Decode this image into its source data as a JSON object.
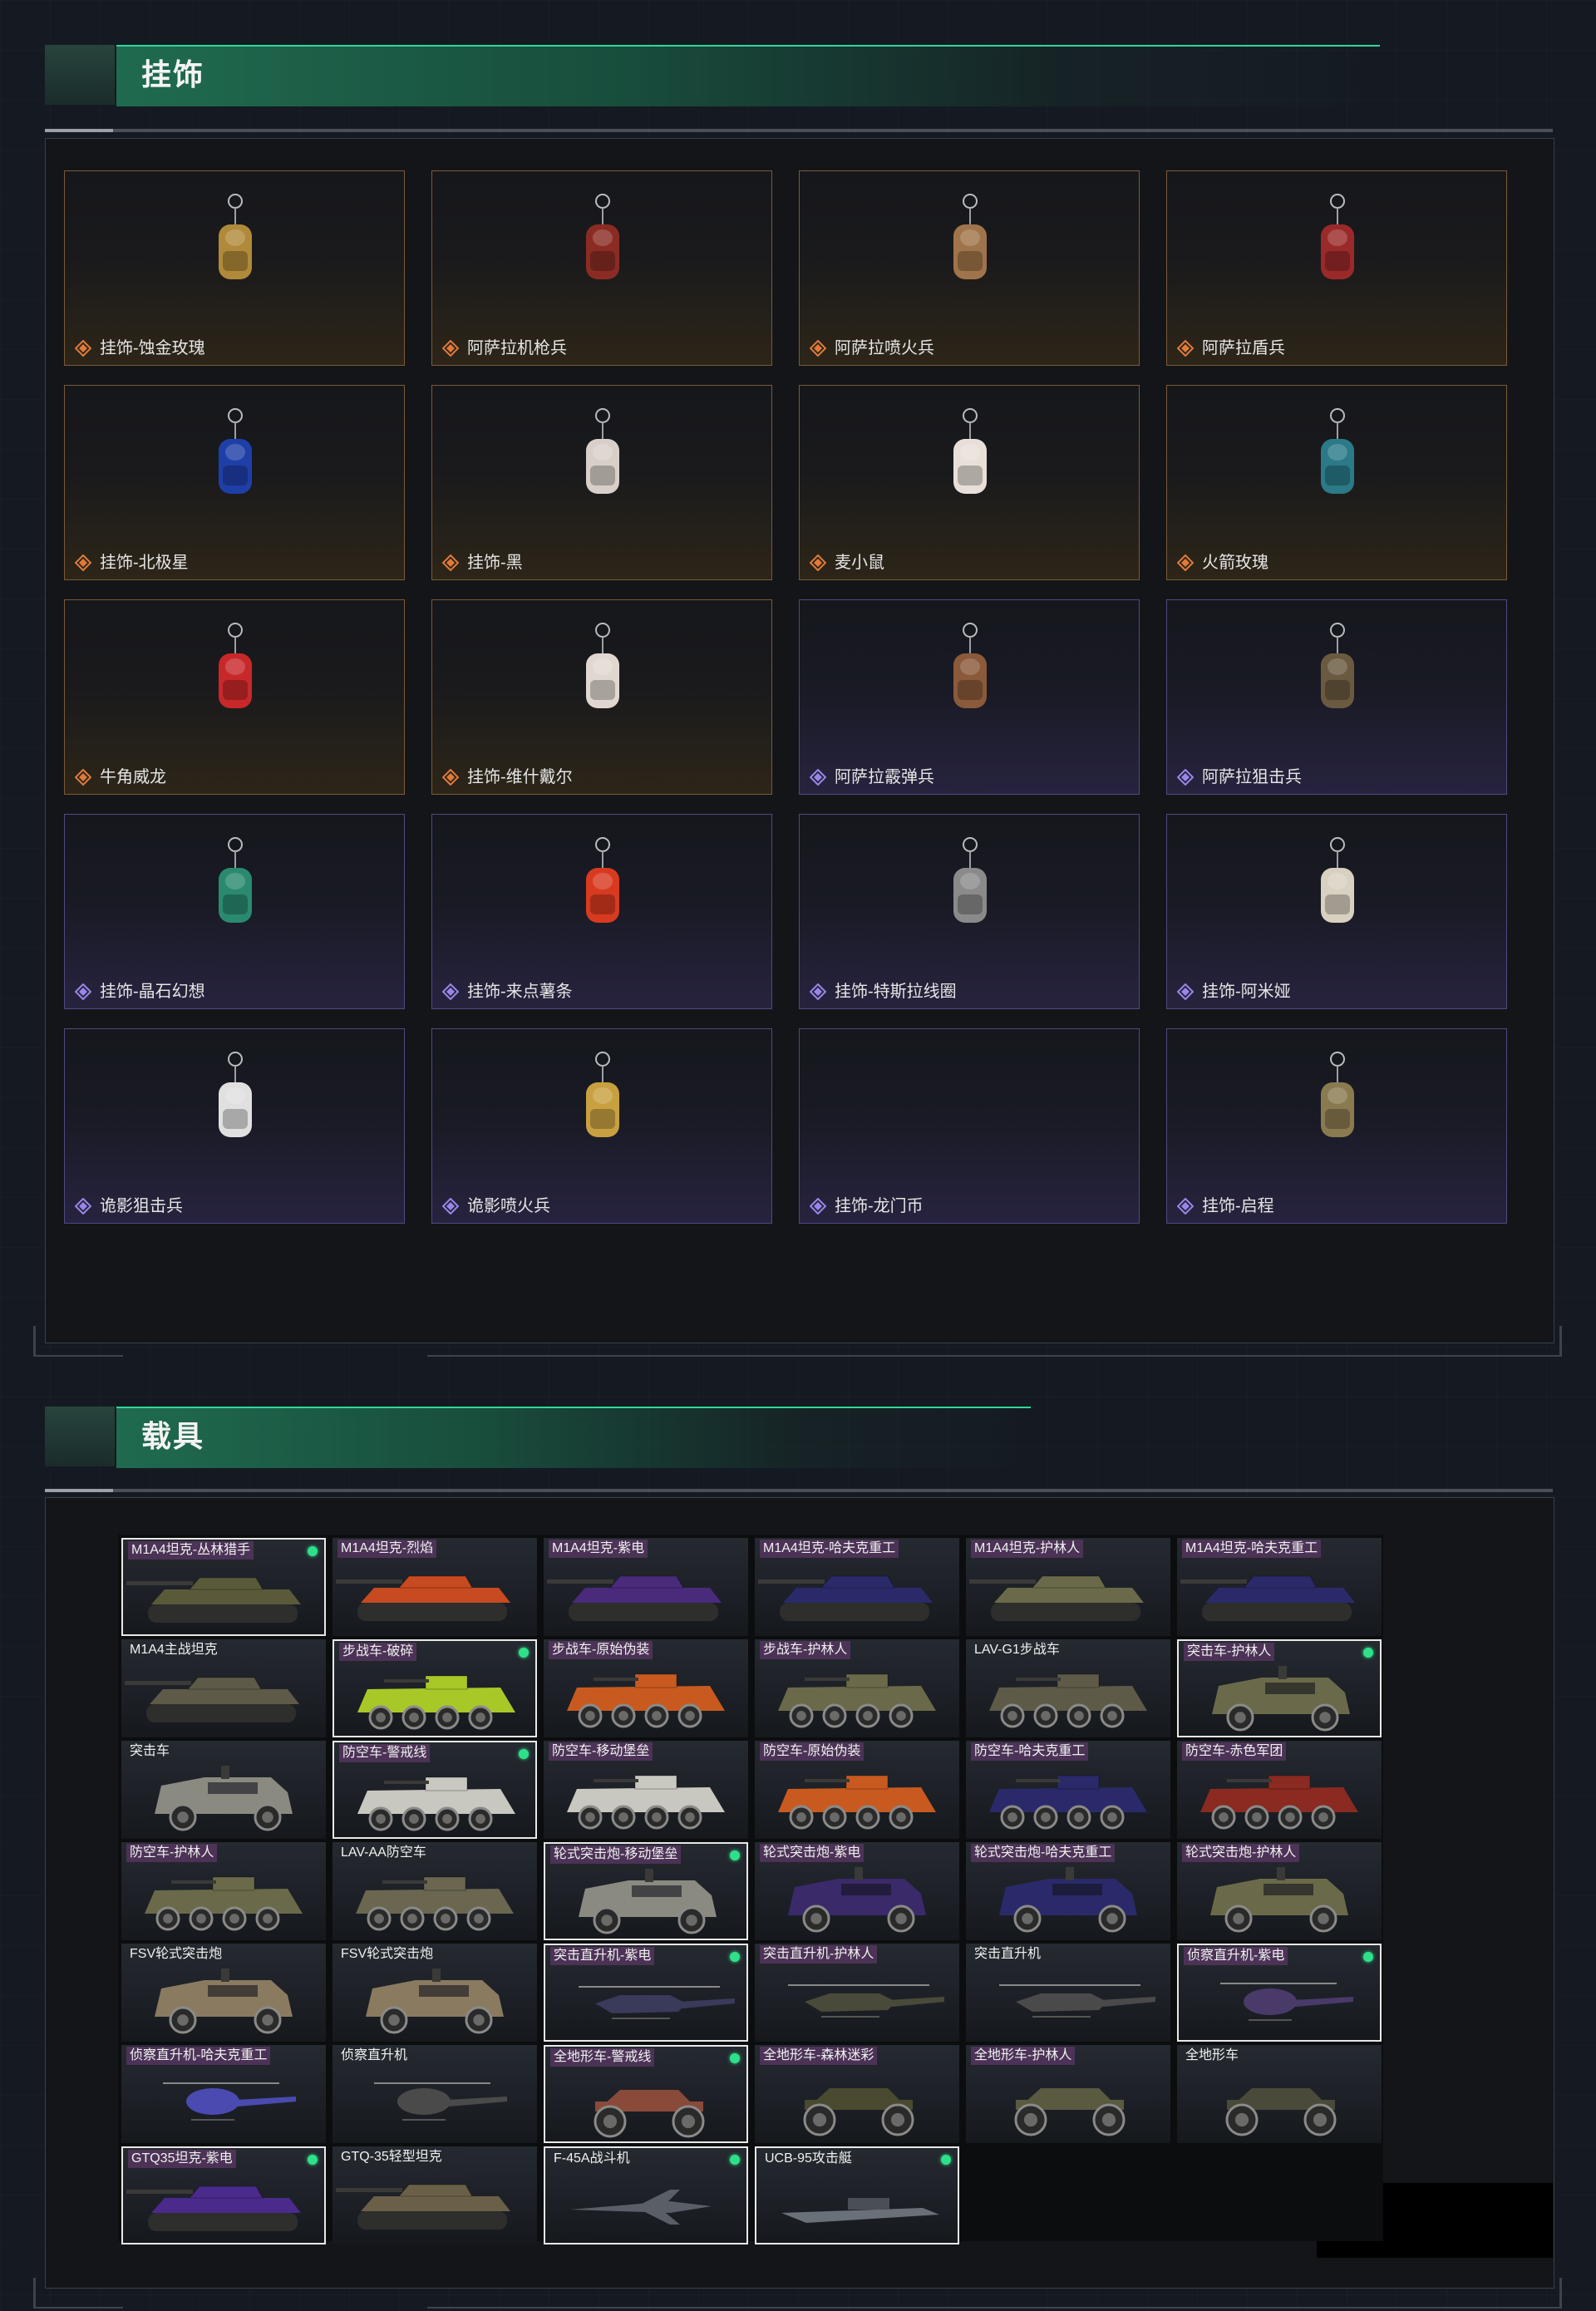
{
  "sections": {
    "charms": {
      "title": "挂饰"
    },
    "vehicles": {
      "title": "载具"
    }
  },
  "charms": [
    {
      "label": "挂饰-蚀金玫瑰",
      "rarity": "gold",
      "icon": "rose-emblem-charm-icon",
      "color": "#b08a3a"
    },
    {
      "label": "阿萨拉机枪兵",
      "rarity": "gold",
      "icon": "machine-gunner-figure-icon",
      "color": "#8a2c24"
    },
    {
      "label": "阿萨拉喷火兵",
      "rarity": "gold",
      "icon": "flamethrower-figure-icon",
      "color": "#a0744a"
    },
    {
      "label": "阿萨拉盾兵",
      "rarity": "gold",
      "icon": "shield-soldier-figure-icon",
      "color": "#9a2a2a"
    },
    {
      "label": "挂饰-北极星",
      "rarity": "gold",
      "icon": "polaris-charm-icon",
      "color": "#1f3fa8"
    },
    {
      "label": "挂饰-黑",
      "rarity": "gold",
      "icon": "black-blade-charm-icon",
      "color": "#d8d0c8"
    },
    {
      "label": "麦小鼠",
      "rarity": "gold",
      "icon": "mouse-doll-icon",
      "color": "#e8e0d8"
    },
    {
      "label": "火箭玫瑰",
      "rarity": "gold",
      "icon": "rocket-rose-doll-icon",
      "color": "#2a7a88"
    },
    {
      "label": "牛角威龙",
      "rarity": "gold",
      "icon": "horned-dragon-doll-icon",
      "color": "#c8282a"
    },
    {
      "label": "挂饰-维什戴尔",
      "rarity": "gold",
      "icon": "blade-charm-icon",
      "color": "#e0d8d0"
    },
    {
      "label": "阿萨拉霰弹兵",
      "rarity": "purple",
      "icon": "shotgunner-figure-icon",
      "color": "#8a5a3a"
    },
    {
      "label": "阿萨拉狙击兵",
      "rarity": "purple",
      "icon": "sniper-figure-icon",
      "color": "#6a5a40"
    },
    {
      "label": "挂饰-晶石幻想",
      "rarity": "purple",
      "icon": "crystal-charm-icon",
      "color": "#2a8a70"
    },
    {
      "label": "挂饰-来点薯条",
      "rarity": "purple",
      "icon": "fries-charm-icon",
      "color": "#d83a20"
    },
    {
      "label": "挂饰-特斯拉线圈",
      "rarity": "purple",
      "icon": "tesla-coil-charm-icon",
      "color": "#8a8a8a"
    },
    {
      "label": "挂饰-阿米娅",
      "rarity": "purple",
      "icon": "amiya-doll-icon",
      "color": "#d8d0c0"
    },
    {
      "label": "诡影狙击兵",
      "rarity": "purple",
      "icon": "ghost-sniper-doll-icon",
      "color": "#e0e0e0"
    },
    {
      "label": "诡影喷火兵",
      "rarity": "purple",
      "icon": "ghost-flamer-doll-icon",
      "color": "#c8a040"
    },
    {
      "label": "挂饰-龙门币",
      "rarity": "purple",
      "icon": "",
      "color": ""
    },
    {
      "label": "挂饰-启程",
      "rarity": "purple",
      "icon": "departure-medal-charm-icon",
      "color": "#8a7a50"
    }
  ],
  "vehicles": [
    {
      "label": "M1A4坦克-丛林猎手",
      "kind": "tank",
      "selected": true,
      "owned": true,
      "tagged": true,
      "color": "#5a5a3a"
    },
    {
      "label": "M1A4坦克-烈焰",
      "kind": "tank",
      "selected": false,
      "owned": false,
      "tagged": true,
      "color": "#c84a20"
    },
    {
      "label": "M1A4坦克-紫电",
      "kind": "tank",
      "selected": false,
      "owned": false,
      "tagged": true,
      "color": "#4a2a7a"
    },
    {
      "label": "M1A4坦克-哈夫克重工",
      "kind": "tank",
      "selected": false,
      "owned": false,
      "tagged": true,
      "color": "#2a2a6a"
    },
    {
      "label": "M1A4坦克-护林人",
      "kind": "tank",
      "selected": false,
      "owned": false,
      "tagged": true,
      "color": "#6a6a4a"
    },
    {
      "label": "M1A4坦克-哈夫克重工",
      "kind": "tank",
      "selected": false,
      "owned": false,
      "tagged": true,
      "color": "#2a2a6a"
    },
    {
      "label": "M1A4主战坦克",
      "kind": "tank",
      "selected": false,
      "owned": false,
      "tagged": false,
      "color": "#5e5a48"
    },
    {
      "label": "步战车-破碎",
      "kind": "ifv",
      "selected": true,
      "owned": true,
      "tagged": true,
      "color": "#a8c828"
    },
    {
      "label": "步战车-原始伪装",
      "kind": "ifv",
      "selected": false,
      "owned": false,
      "tagged": true,
      "color": "#c85a20"
    },
    {
      "label": "步战车-护林人",
      "kind": "ifv",
      "selected": false,
      "owned": false,
      "tagged": true,
      "color": "#6a6a4a"
    },
    {
      "label": "LAV-G1步战车",
      "kind": "ifv",
      "selected": false,
      "owned": false,
      "tagged": false,
      "color": "#5e5a48"
    },
    {
      "label": "突击车-护林人",
      "kind": "jeep",
      "selected": true,
      "owned": true,
      "tagged": true,
      "color": "#6a6a4a"
    },
    {
      "label": "突击车",
      "kind": "jeep",
      "selected": false,
      "owned": false,
      "tagged": false,
      "color": "#8a8a80"
    },
    {
      "label": "防空车-警戒线",
      "kind": "aa",
      "selected": true,
      "owned": true,
      "tagged": true,
      "color": "#c8c8c0"
    },
    {
      "label": "防空车-移动堡垒",
      "kind": "aa",
      "selected": false,
      "owned": false,
      "tagged": true,
      "color": "#c8c8c0"
    },
    {
      "label": "防空车-原始伪装",
      "kind": "aa",
      "selected": false,
      "owned": false,
      "tagged": true,
      "color": "#c85a20"
    },
    {
      "label": "防空车-哈夫克重工",
      "kind": "aa",
      "selected": false,
      "owned": false,
      "tagged": true,
      "color": "#2a2a6a"
    },
    {
      "label": "防空车-赤色军团",
      "kind": "aa",
      "selected": false,
      "owned": false,
      "tagged": true,
      "color": "#8a2a20"
    },
    {
      "label": "防空车-护林人",
      "kind": "ifv",
      "selected": false,
      "owned": false,
      "tagged": true,
      "color": "#6a6a4a"
    },
    {
      "label": "LAV-AA防空车",
      "kind": "ifv",
      "selected": false,
      "owned": false,
      "tagged": false,
      "color": "#6a6650"
    },
    {
      "label": "轮式突击炮-移动堡垒",
      "kind": "jeep",
      "selected": true,
      "owned": true,
      "tagged": true,
      "color": "#8a8a80"
    },
    {
      "label": "轮式突击炮-紫电",
      "kind": "jeep",
      "selected": false,
      "owned": false,
      "tagged": true,
      "color": "#3a2a6a"
    },
    {
      "label": "轮式突击炮-哈夫克重工",
      "kind": "jeep",
      "selected": false,
      "owned": false,
      "tagged": true,
      "color": "#2a2a6a"
    },
    {
      "label": "轮式突击炮-护林人",
      "kind": "jeep",
      "selected": false,
      "owned": false,
      "tagged": true,
      "color": "#6a6a4a"
    },
    {
      "label": "FSV轮式突击炮",
      "kind": "jeep",
      "selected": false,
      "owned": false,
      "tagged": false,
      "color": "#8a7a60"
    },
    {
      "label": "FSV轮式突击炮",
      "kind": "jeep",
      "selected": false,
      "owned": false,
      "tagged": false,
      "color": "#8a7a60"
    },
    {
      "label": "突击直升机-紫电",
      "kind": "heli",
      "selected": true,
      "owned": true,
      "tagged": true,
      "color": "#3a3a5a"
    },
    {
      "label": "突击直升机-护林人",
      "kind": "heli",
      "selected": false,
      "owned": false,
      "tagged": true,
      "color": "#4a4a3a"
    },
    {
      "label": "突击直升机",
      "kind": "heli",
      "selected": false,
      "owned": false,
      "tagged": false,
      "color": "#4a4a4a"
    },
    {
      "label": "侦察直升机-紫电",
      "kind": "heli2",
      "selected": true,
      "owned": true,
      "tagged": true,
      "color": "#4a3a6a"
    },
    {
      "label": "侦察直升机-哈夫克重工",
      "kind": "heli2",
      "selected": false,
      "owned": false,
      "tagged": true,
      "color": "#4a4ab0"
    },
    {
      "label": "侦察直升机",
      "kind": "heli2",
      "selected": false,
      "owned": false,
      "tagged": false,
      "color": "#4a4a4a"
    },
    {
      "label": "全地形车-警戒线",
      "kind": "atv",
      "selected": true,
      "owned": true,
      "tagged": true,
      "color": "#8a4a3a"
    },
    {
      "label": "全地形车-森林迷彩",
      "kind": "atv",
      "selected": false,
      "owned": false,
      "tagged": true,
      "color": "#4a4a30"
    },
    {
      "label": "全地形车-护林人",
      "kind": "atv",
      "selected": false,
      "owned": false,
      "tagged": true,
      "color": "#5a5a40"
    },
    {
      "label": "全地形车",
      "kind": "atv",
      "selected": false,
      "owned": false,
      "tagged": false,
      "color": "#4a4a3a"
    },
    {
      "label": "GTQ35坦克-紫电",
      "kind": "tank",
      "selected": true,
      "owned": true,
      "tagged": true,
      "color": "#4a2a8a"
    },
    {
      "label": "GTQ-35轻型坦克",
      "kind": "tank",
      "selected": false,
      "owned": false,
      "tagged": false,
      "color": "#6a6048"
    },
    {
      "label": "F-45A战斗机",
      "kind": "jet",
      "selected": true,
      "owned": true,
      "tagged": false,
      "color": "#5a5e66"
    },
    {
      "label": "UCB-95攻击艇",
      "kind": "boat",
      "selected": true,
      "owned": true,
      "tagged": false,
      "color": "#6a7078"
    }
  ],
  "colors": {
    "accent_green": "#2fd79a",
    "gold_frame": "#7a5a38",
    "gold_icon": "#e07a3a",
    "purple_frame": "#4e4a82",
    "purple_icon": "#9a86e8",
    "owned_dot": "#2fe08a"
  }
}
